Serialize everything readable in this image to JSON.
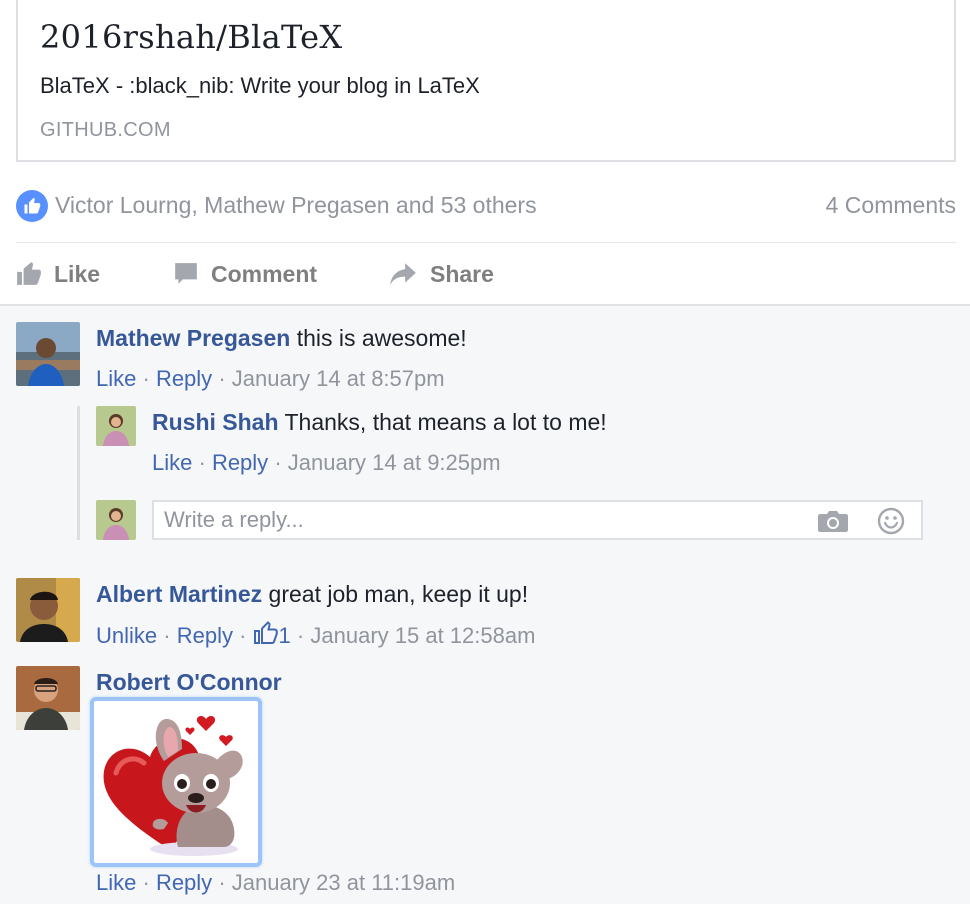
{
  "link_card": {
    "title": "2016rshah/BlaTeX",
    "description": "BlaTeX - :black_nib: Write your blog in LaTeX",
    "domain": "GITHUB.COM"
  },
  "summary": {
    "reactors_text": "Victor Lourng, Mathew Pregasen and 53 others",
    "comments_count": "4 Comments",
    "like_icon": "thumbs-up-icon",
    "badge_color": "#5890ff"
  },
  "actions": {
    "like": "Like",
    "comment": "Comment",
    "share": "Share"
  },
  "comments": [
    {
      "author": "Mathew Pregasen",
      "text": "this is awesome!",
      "like": "Like",
      "reply": "Reply",
      "time": "January 14 at 8:57pm"
    },
    {
      "author": "Albert Martinez",
      "text": "great job man, keep it up!",
      "like": "Unlike",
      "reply": "Reply",
      "like_count": "1",
      "time": "January 15 at 12:58am"
    },
    {
      "author": "Robert O'Connor",
      "text": "",
      "like": "Like",
      "reply": "Reply",
      "time": "January 23 at 11:19am"
    }
  ],
  "reply": {
    "author": "Rushi Shah",
    "text": "Thanks, that means a lot to me!",
    "like": "Like",
    "reply": "Reply",
    "time": "January 14 at 9:25pm"
  },
  "reply_box": {
    "placeholder": "Write a reply..."
  },
  "separator": "·",
  "link_color": "#365899"
}
